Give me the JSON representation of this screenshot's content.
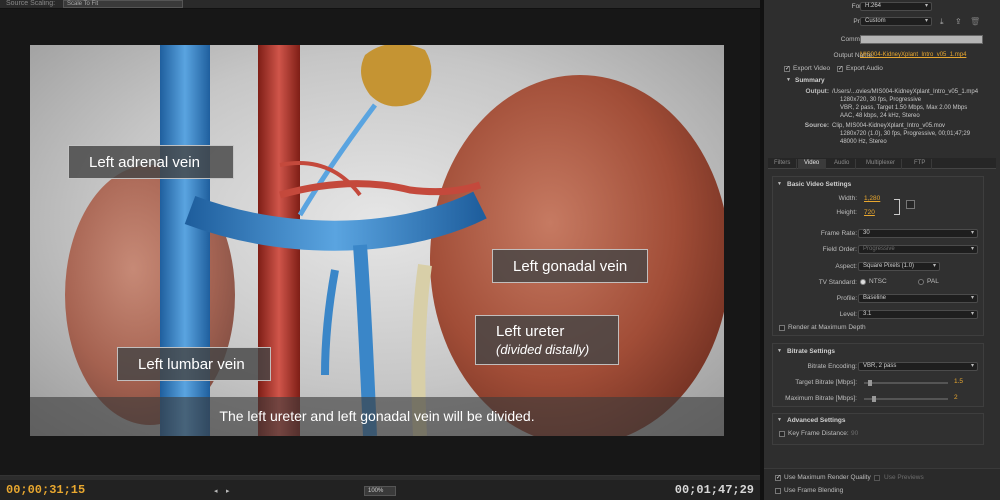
{
  "source": {
    "label": "Source Scaling:",
    "value": "Scale To Fit"
  },
  "video": {
    "labels": [
      {
        "id": "adrenal",
        "text": "Left adrenal vein"
      },
      {
        "id": "lumbar",
        "text": "Left lumbar vein"
      },
      {
        "id": "gonadal",
        "text": "Left gonadal vein"
      },
      {
        "id": "ureter",
        "text": "Left ureter",
        "sub": "(divided distally)"
      }
    ],
    "caption": "The left ureter and left gonadal vein will be divided."
  },
  "playback": {
    "current_time": "00;00;31;15",
    "duration": "00;01;47;29",
    "zoom": "100%"
  },
  "export": {
    "format_label": "Format:",
    "format_value": "H.264",
    "preset_label": "Preset:",
    "preset_value": "Custom",
    "comments_label": "Comments:",
    "output_name_label": "Output Name:",
    "output_name_value": "MIS004-KidneyXplant_Intro_v05_1.mp4",
    "export_video": "Export Video",
    "export_audio": "Export Audio"
  },
  "summary": {
    "title": "Summary",
    "output_label": "Output:",
    "output_lines": [
      "/Users/...ovies/MIS004-KidneyXplant_Intro_v05_1.mp4",
      "1280x720, 30 fps, Progressive",
      "VBR, 2 pass, Target 1.50 Mbps, Max 2.00 Mbps",
      "AAC, 48 kbps, 24 kHz, Stereo"
    ],
    "source_label": "Source:",
    "source_lines": [
      "Clip, MIS004-KidneyXplant_Intro_v05.mov",
      "1280x720 (1.0), 30 fps, Progressive, 00;01;47;29",
      "48000 Hz, Stereo"
    ]
  },
  "tabs": [
    "Filters",
    "Video",
    "Audio",
    "Multiplexer",
    "FTP"
  ],
  "basic_video": {
    "title": "Basic Video Settings",
    "width_label": "Width:",
    "width_value": "1,280",
    "height_label": "Height:",
    "height_value": "720",
    "frame_rate_label": "Frame Rate:",
    "frame_rate_value": "30",
    "field_order_label": "Field Order:",
    "field_order_value": "Progressive",
    "aspect_label": "Aspect:",
    "aspect_value": "Square Pixels (1.0)",
    "tv_standard_label": "TV Standard:",
    "ntsc": "NTSC",
    "pal": "PAL",
    "profile_label": "Profile:",
    "profile_value": "Baseline",
    "level_label": "Level:",
    "level_value": "3.1",
    "max_depth": "Render at Maximum Depth"
  },
  "bitrate": {
    "title": "Bitrate Settings",
    "encoding_label": "Bitrate Encoding:",
    "encoding_value": "VBR, 2 pass",
    "target_label": "Target Bitrate [Mbps]:",
    "target_value": "1.5",
    "max_label": "Maximum Bitrate [Mbps]:",
    "max_value": "2"
  },
  "advanced": {
    "title": "Advanced Settings",
    "key_frame": "Key Frame Distance:",
    "key_frame_value": "90"
  },
  "footer": {
    "max_quality": "Use Maximum Render Quality",
    "use_previews": "Use Previews",
    "frame_blending": "Use Frame Blending"
  },
  "colors": {
    "accent": "#e8a72f",
    "vein": "#3a86c8",
    "artery": "#b83a2e",
    "kidney": "#a9523c"
  }
}
